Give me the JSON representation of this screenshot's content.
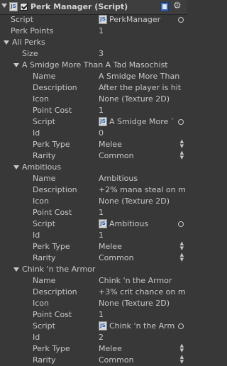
{
  "header": {
    "title": "Perk Manager (Script)"
  },
  "script_row": {
    "label": "Script",
    "value": "PerkManager"
  },
  "perk_points": {
    "label": "Perk Points",
    "value": "1"
  },
  "all_perks": {
    "label": "All Perks",
    "size_label": "Size",
    "size_value": "3"
  },
  "field_labels": {
    "name": "Name",
    "description": "Description",
    "icon": "Icon",
    "point_cost": "Point Cost",
    "script": "Script",
    "id": "Id",
    "perk_type": "Perk Type",
    "rarity": "Rarity"
  },
  "perks": [
    {
      "title": "A Smidge More Than A Tad Masochist",
      "name": "A Smidge More Than",
      "description": "After the player is hit",
      "icon": "None (Texture 2D)",
      "point_cost": "1",
      "script": "A Smidge More `",
      "id": "0",
      "perk_type": "Melee",
      "rarity": "Common"
    },
    {
      "title": "Ambitious",
      "name": "Ambitious",
      "description": "+2% mana steal on m",
      "icon": "None (Texture 2D)",
      "point_cost": "1",
      "script": "Ambitious",
      "id": "1",
      "perk_type": "Melee",
      "rarity": "Common"
    },
    {
      "title": "Chink 'n the Armor",
      "name": "Chink 'n the Armor",
      "description": "+3% crit chance on m",
      "icon": "None (Texture 2D)",
      "point_cost": "1",
      "script": "Chink 'n the Arm",
      "id": "2",
      "perk_type": "Melee",
      "rarity": "Common"
    }
  ]
}
